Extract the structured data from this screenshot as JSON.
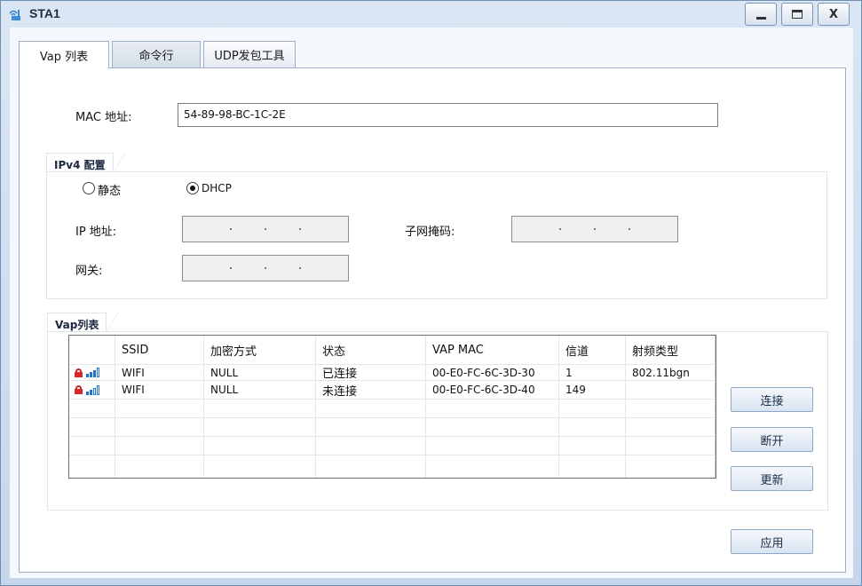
{
  "window": {
    "title": "STA1",
    "close_label": "X"
  },
  "tabs": [
    {
      "label": "Vap 列表"
    },
    {
      "label": "命令行"
    },
    {
      "label": "UDP发包工具"
    }
  ],
  "mac": {
    "label": "MAC 地址:",
    "value": "54-89-98-BC-1C-2E"
  },
  "ipv4": {
    "title": "IPv4 配置",
    "static_label": "静态",
    "dhcp_label": "DHCP",
    "ip_label": "IP 地址:",
    "mask_label": "子网掩码:",
    "gateway_label": "网关:"
  },
  "vap": {
    "title": "Vap列表",
    "columns": [
      "SSID",
      "加密方式",
      "状态",
      "VAP MAC",
      "信道",
      "射频类型"
    ],
    "rows": [
      {
        "ssid": "WIFI",
        "encryption": "NULL",
        "status": "已连接",
        "mac": "00-E0-FC-6C-3D-30",
        "channel": "1",
        "radio": "802.11bgn",
        "signal": 4
      },
      {
        "ssid": "WIFI",
        "encryption": "NULL",
        "status": "未连接",
        "mac": "00-E0-FC-6C-3D-40",
        "channel": "149",
        "radio": "",
        "signal": 2
      }
    ]
  },
  "buttons": {
    "connect": "连接",
    "disconnect": "断开",
    "refresh": "更新",
    "apply": "应用"
  },
  "colors": {
    "signal": "#1f73c8",
    "lock": "#d8262b"
  }
}
